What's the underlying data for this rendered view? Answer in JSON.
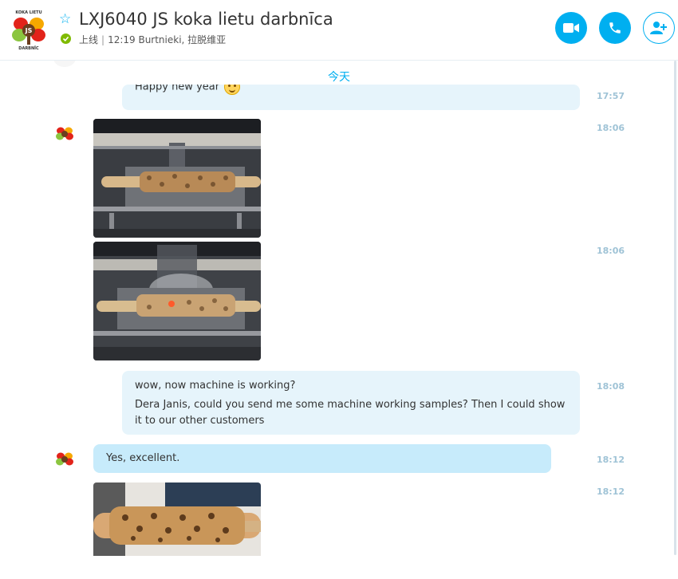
{
  "header": {
    "title": "LXJ6040 JS koka lietu darbnīca",
    "status": "上线",
    "local_time": "12:19 Burtnieki, 拉脱维亚",
    "logo_text_top": "KOKA LIETU",
    "logo_text_mid": "JS",
    "logo_text_bottom": "DARBNĪC"
  },
  "chat": {
    "date_separator": "今天",
    "messages": [
      {
        "text": "Happy new year",
        "time": "17:57",
        "emoji": "smile-emoji"
      },
      {
        "media": "image",
        "time": "18:06"
      },
      {
        "media": "image",
        "time": "18:06"
      },
      {
        "lines": [
          "wow, now machine is working?",
          "Dera Janis, could you send me some machine working samples? Then I could show it to our other customers"
        ],
        "time": "18:08"
      },
      {
        "text": "Yes, excellent.",
        "time": "18:12"
      },
      {
        "media": "image",
        "time": "18:12"
      }
    ]
  },
  "colors": {
    "accent": "#00aff0",
    "online": "#7fba00",
    "outgoing_bubble": "#e6f4fb",
    "incoming_bubble": "#c7ebfb",
    "timestamp": "#9fc3d6"
  }
}
